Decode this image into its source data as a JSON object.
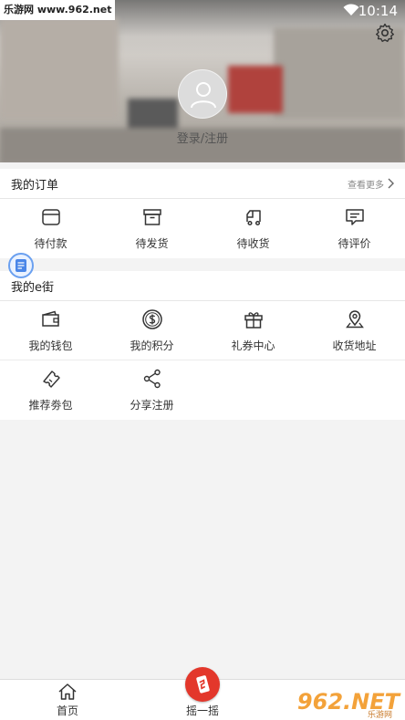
{
  "statusbar": {
    "watermark": "乐游网 www.962.net",
    "time": "10:14"
  },
  "profile": {
    "login_label": "登录/注册"
  },
  "orders": {
    "title": "我的订单",
    "more": "查看更多",
    "items": [
      {
        "label": "待付款",
        "icon": "wallet-card-icon"
      },
      {
        "label": "待发货",
        "icon": "box-icon"
      },
      {
        "label": "待收货",
        "icon": "truck-icon"
      },
      {
        "label": "待评价",
        "icon": "comment-icon"
      }
    ]
  },
  "estreet": {
    "title": "我的e街",
    "items": [
      {
        "label": "我的钱包",
        "icon": "wallet-icon"
      },
      {
        "label": "我的积分",
        "icon": "coin-icon"
      },
      {
        "label": "礼券中心",
        "icon": "gift-icon"
      },
      {
        "label": "收货地址",
        "icon": "location-icon"
      },
      {
        "label": "推荐劵包",
        "icon": "ticket-icon"
      },
      {
        "label": "分享注册",
        "icon": "share-icon"
      }
    ]
  },
  "nav": {
    "home": "首页",
    "shake": "摇一摇"
  },
  "watermark_bottom": "962.NET",
  "watermark_bottom_sub": "乐游网",
  "colors": {
    "accent": "#e3372b",
    "float_icon": "#6aa0f0"
  }
}
